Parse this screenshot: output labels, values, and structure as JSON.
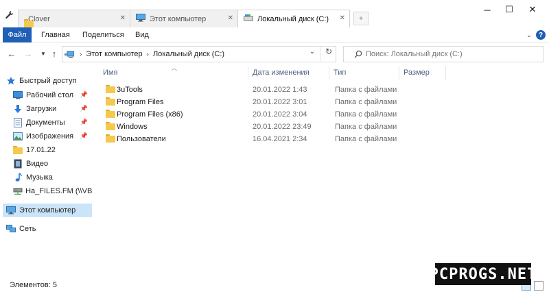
{
  "tabs": [
    {
      "title": "Clover",
      "close": "✕"
    },
    {
      "title": "Этот компьютер",
      "close": "✕"
    },
    {
      "title": "Локальный диск (C:)",
      "close": "✕"
    }
  ],
  "ribbon": {
    "file": "Файл",
    "home": "Главная",
    "share": "Поделиться",
    "view": "Вид"
  },
  "address": {
    "crumbs": [
      "Этот компьютер",
      "Локальный диск (C:)"
    ]
  },
  "search": {
    "placeholder": "Поиск: Локальный диск (C:)"
  },
  "navpane": {
    "quick_access": "Быстрый доступ",
    "items": [
      {
        "label": "Рабочий стол",
        "icon": "desktop-icon",
        "pinned": true
      },
      {
        "label": "Загрузки",
        "icon": "download-icon",
        "pinned": true
      },
      {
        "label": "Документы",
        "icon": "documents-icon",
        "pinned": true
      },
      {
        "label": "Изображения",
        "icon": "pictures-icon",
        "pinned": true
      },
      {
        "label": "17.01.22",
        "icon": "folder-icon",
        "pinned": false
      },
      {
        "label": "Видео",
        "icon": "video-icon",
        "pinned": false
      },
      {
        "label": "Музыка",
        "icon": "music-icon",
        "pinned": false
      },
      {
        "label": "На_FILES.FM (\\\\VBc",
        "icon": "network-drive-icon",
        "pinned": false
      }
    ],
    "this_pc": "Этот компьютер",
    "network": "Сеть"
  },
  "columns": {
    "name": "Имя",
    "date": "Дата изменения",
    "type": "Тип",
    "size": "Размер"
  },
  "files": [
    {
      "name": "3uTools",
      "date": "20.01.2022 1:43",
      "type": "Папка с файлами"
    },
    {
      "name": "Program Files",
      "date": "20.01.2022 3:01",
      "type": "Папка с файлами"
    },
    {
      "name": "Program Files (x86)",
      "date": "20.01.2022 3:04",
      "type": "Папка с файлами"
    },
    {
      "name": "Windows",
      "date": "20.01.2022 23:49",
      "type": "Папка с файлами"
    },
    {
      "name": "Пользователи",
      "date": "16.04.2021 2:34",
      "type": "Папка с файлами"
    }
  ],
  "status": {
    "count": "Элементов: 5"
  },
  "watermark": "PCPROGS.NET",
  "colors": {
    "accent": "#1f5fb5",
    "folder": "#f5c94d",
    "selected": "#cce4f7"
  }
}
